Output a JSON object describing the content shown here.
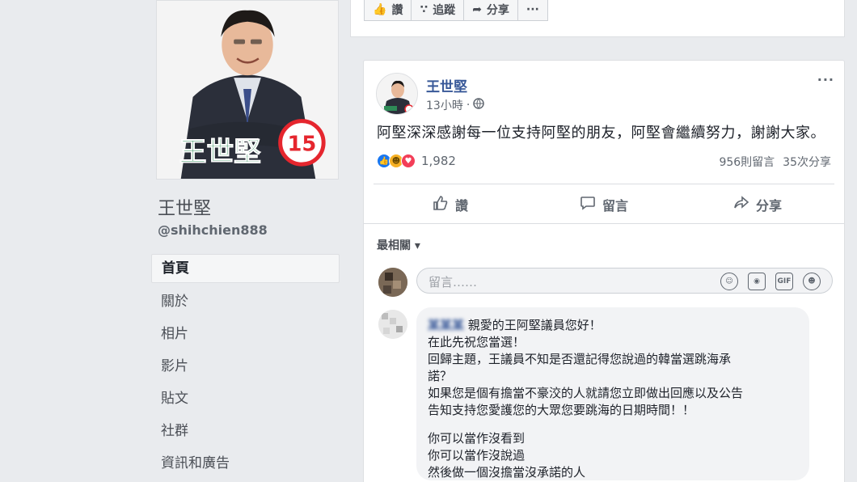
{
  "top_actions": [
    {
      "icon": "thumbs-up-icon",
      "label": "讚"
    },
    {
      "icon": "rss-icon",
      "label": "追蹤"
    },
    {
      "icon": "share-arrow-icon",
      "label": "分享"
    },
    {
      "icon": "more-dots-icon",
      "label": "···"
    }
  ],
  "profile": {
    "name": "王世堅",
    "handle": "@shihchien888",
    "badge_number": "15",
    "poster_name": "王世堅"
  },
  "nav": {
    "items": [
      {
        "label": "首頁"
      },
      {
        "label": "關於"
      },
      {
        "label": "相片"
      },
      {
        "label": "影片"
      },
      {
        "label": "貼文"
      },
      {
        "label": "社群"
      },
      {
        "label": "資訊和廣告"
      }
    ]
  },
  "post": {
    "author": "王世堅",
    "time": "13小時",
    "more": "···",
    "text": "阿堅深深感謝每一位支持阿堅的朋友，阿堅會繼續努力，謝謝大家。",
    "reaction_count": "1,982",
    "comments_count": "956則留言",
    "shares_count": "35次分享",
    "actions": [
      {
        "icon": "like-icon",
        "label": "讚"
      },
      {
        "icon": "comment-icon",
        "label": "留言"
      },
      {
        "icon": "share-icon",
        "label": "分享"
      }
    ],
    "sort_label": "最相關 ▾",
    "comment_placeholder": "留言……",
    "input_icons": [
      "smiley-icon",
      "camera-icon",
      "gif-icon",
      "sticker-icon"
    ]
  },
  "comment": {
    "author": "某某某",
    "lines": [
      "親愛的王阿堅議員您好！",
      "在此先祝您當選！",
      "回歸主題，王議員不知是否還記得您說過的韓當選跳海承",
      "諾？",
      "如果您是個有擔當不豪洨的人就請您立即做出回應以及公告",
      "告知支持您愛護您的大眾您要跳海的日期時間！！",
      "",
      "你可以當作沒看到",
      "你可以當作沒說過",
      "然後做一個沒擔當沒承諾的人"
    ]
  },
  "colors": {
    "link": "#385898",
    "like_blue": "#1877f2",
    "love_red": "#f33e58",
    "haha_yellow": "#f7b125",
    "badge_red": "#e5262e",
    "poster_green": "#2e8b57"
  }
}
